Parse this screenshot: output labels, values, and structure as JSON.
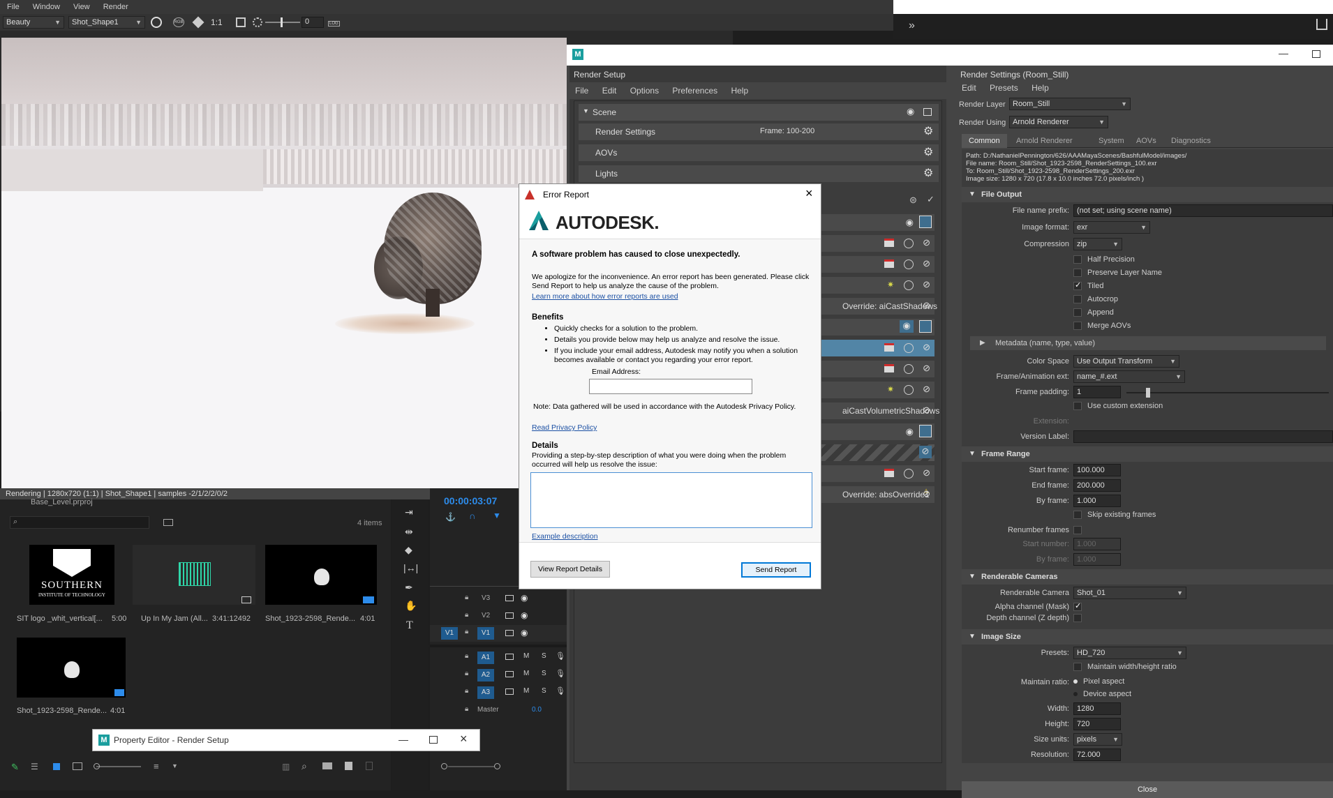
{
  "render_view": {
    "menu": [
      "File",
      "Window",
      "View",
      "Render"
    ],
    "aov_dropdown": "Beauty",
    "camera_dropdown": "Shot_Shape1",
    "ratio_label": "1:1",
    "exposure_value": "0",
    "log_label": "LOG",
    "status_bar": "Rendering | 1280x720 (1:1) | Shot_Shape1 | samples -2/1/2/2/0/2"
  },
  "render_setup": {
    "window_icon": "M",
    "title": "Render Setup",
    "menu": [
      "File",
      "Edit",
      "Options",
      "Preferences",
      "Help"
    ],
    "scene_label": "Scene",
    "rows": [
      {
        "label": "Render Settings",
        "value": "Frame: 100-200"
      },
      {
        "label": "AOVs",
        "value": ""
      },
      {
        "label": "Lights",
        "value": ""
      }
    ],
    "overrides": [
      {
        "label": "Override:  aiCastShadows"
      },
      {
        "label": "aiCastVolumetricShadows"
      },
      {
        "label": "Override:  absOverride1"
      }
    ]
  },
  "render_settings": {
    "title": "Render Settings (Room_Still)",
    "menu": [
      "Edit",
      "Presets",
      "Help"
    ],
    "render_layer_label": "Render Layer",
    "render_layer_value": "Room_Still",
    "render_using_label": "Render Using",
    "render_using_value": "Arnold Renderer",
    "tabs": [
      "Common",
      "Arnold Renderer",
      "System",
      "AOVs",
      "Diagnostics"
    ],
    "path_info": [
      "Path: D:/NathanielPennington/626/AAAMayaScenes/BashfulModel/images/",
      "File name:  Room_Still/Shot_1923-2598_RenderSettings_100.exr",
      "To:            Room_Still/Shot_1923-2598_RenderSettings_200.exr",
      "Image size: 1280 x 720 (17.8 x 10.0 inches 72.0 pixels/inch )"
    ],
    "file_output": {
      "header": "File Output",
      "prefix_label": "File name prefix:",
      "prefix_value": "(not set; using scene name)",
      "format_label": "Image format:",
      "format_value": "exr",
      "compression_label": "Compression",
      "compression_value": "zip",
      "checks": [
        {
          "label": "Half Precision",
          "checked": false
        },
        {
          "label": "Preserve Layer Name",
          "checked": false
        },
        {
          "label": "Tiled",
          "checked": true
        },
        {
          "label": "Autocrop",
          "checked": false
        },
        {
          "label": "Append",
          "checked": false
        },
        {
          "label": "Merge AOVs",
          "checked": false
        }
      ],
      "metadata_label": "Metadata (name, type, value)",
      "color_space_label": "Color Space",
      "color_space_value": "Use Output Transform",
      "frame_ext_label": "Frame/Animation ext:",
      "frame_ext_value": "name_#.ext",
      "frame_padding_label": "Frame padding:",
      "frame_padding_value": "1",
      "custom_ext_label": "Use custom extension",
      "extension_label": "Extension:",
      "version_label": "Version Label:"
    },
    "frame_range": {
      "header": "Frame Range",
      "start_label": "Start frame:",
      "start_value": "100.000",
      "end_label": "End frame:",
      "end_value": "200.000",
      "by_label": "By frame:",
      "by_value": "1.000",
      "skip_label": "Skip existing frames",
      "renumber_label": "Renumber frames",
      "start_number_label": "Start number:",
      "start_number_value": "1.000",
      "by_frame2_label": "By frame:",
      "by_frame2_value": "1.000"
    },
    "renderable_cameras": {
      "header": "Renderable Cameras",
      "camera_label": "Renderable Camera",
      "camera_value": "Shot_01",
      "alpha_label": "Alpha channel (Mask)",
      "depth_label": "Depth channel (Z depth)"
    },
    "image_size": {
      "header": "Image Size",
      "presets_label": "Presets:",
      "presets_value": "HD_720",
      "maintain_wh_label": "Maintain width/height ratio",
      "maintain_ratio_label": "Maintain ratio:",
      "pixel_aspect_label": "Pixel aspect",
      "device_aspect_label": "Device aspect",
      "width_label": "Width:",
      "width_value": "1280",
      "height_label": "Height:",
      "height_value": "720",
      "size_units_label": "Size units:",
      "size_units_value": "pixels",
      "resolution_label": "Resolution:",
      "resolution_value": "72.000"
    },
    "close_label": "Close"
  },
  "error_dialog": {
    "title": "Error Report",
    "brand": "AUTODESK.",
    "headline": "A software problem has caused  to close unexpectedly.",
    "apology": "We apologize for the inconvenience. An error report has been generated. Please click Send Report to help us analyze the cause of the problem.",
    "learn_more": "Learn more about how error reports are used",
    "benefits_header": "Benefits",
    "benefits": [
      "Quickly checks for a solution to the problem.",
      "Details you provide below may help us analyze and resolve the issue.",
      "If you include your email address, Autodesk may notify you when a solution becomes available or contact you regarding your error report."
    ],
    "email_label": "Email Address:",
    "email_value": "",
    "note": "Note: Data gathered will be used in accordance with the Autodesk Privacy Policy.",
    "privacy_link": "Read Privacy Policy",
    "details_header": "Details",
    "details_desc": "Providing a step-by-step description of what you were doing when the problem occurred will help us resolve the issue:",
    "details_value": "",
    "example_link": "Example description",
    "view_button": "View Report Details",
    "send_button": "Send Report"
  },
  "premiere": {
    "project_file": "Base_Level.prproj",
    "item_count": "4 items",
    "timecode": "00:00:03:07",
    "items": [
      {
        "name": "SIT logo _whit_vertical[...",
        "duration": "5:00",
        "logo_main": "SOUTHERN",
        "logo_sub": "INSTITUTE OF TECHNOLOGY"
      },
      {
        "name": "Up In My Jam (All...",
        "duration": "3:41:12492"
      },
      {
        "name": "Shot_1923-2598_Rende...",
        "duration": "4:01"
      },
      {
        "name": "Shot_1923-2598_Rende...",
        "duration": "4:01"
      }
    ],
    "tracks": [
      "V3",
      "V2",
      "V1",
      "A1",
      "A2",
      "A3"
    ],
    "source_track": "V1",
    "master_label": "Master",
    "master_value": "0.0",
    "mute": "M",
    "solo": "S"
  },
  "property_editor": {
    "icon": "M",
    "title": "Property Editor - Render Setup"
  },
  "colors": {
    "maya_bg": "#444444",
    "selected_blue": "#5285a6",
    "autodesk_teal": "#1a9e9e",
    "premiere_blue": "#2d8ceb"
  }
}
